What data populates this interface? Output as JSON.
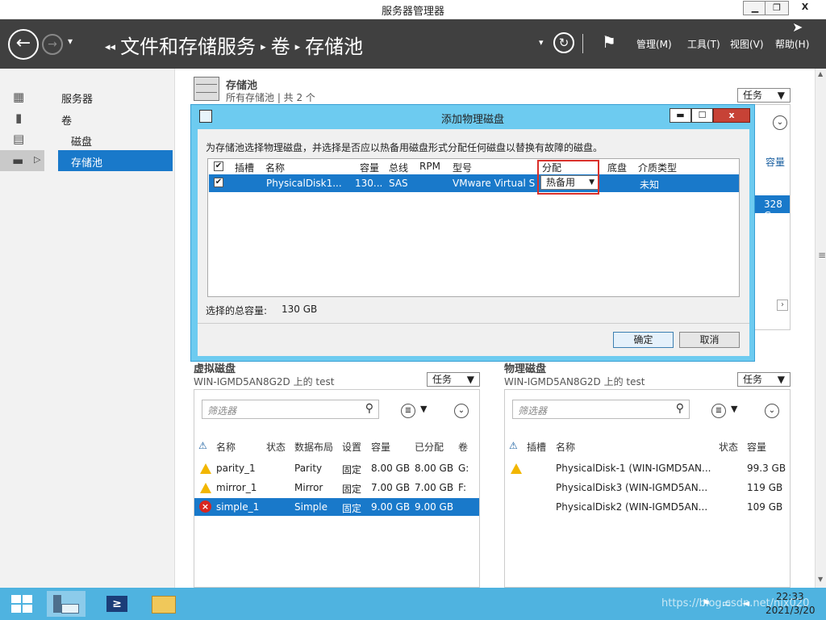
{
  "window": {
    "title": "服务器管理器",
    "min": "▁",
    "restore": "❐",
    "close": "X"
  },
  "header": {
    "breadcrumb": [
      "文件和存储服务",
      "卷",
      "存储池"
    ],
    "menus": [
      "管理(M)",
      "工具(T)",
      "视图(V)",
      "帮助(H)"
    ]
  },
  "nav": {
    "items": [
      "服务器",
      "卷",
      "磁盘",
      "存储池"
    ],
    "selected": "存储池"
  },
  "pool": {
    "title": "存储池",
    "subtitle": "所有存储池 | 共 2 个",
    "tasks": "任务",
    "col_capacity": "容量",
    "capacity_value": "328 G"
  },
  "dialog": {
    "title": "添加物理磁盘",
    "description": "为存储池选择物理磁盘，并选择是否应以热备用磁盘形式分配任何磁盘以替换有故障的磁盘。",
    "columns": [
      "插槽",
      "名称",
      "容量",
      "总线",
      "RPM",
      "型号",
      "分配",
      "底盘",
      "介质类型"
    ],
    "row": {
      "name": "PhysicalDisk1...",
      "capacity": "130...",
      "bus": "SAS",
      "model": "VMware Virtual S",
      "allocation": "热备用",
      "media": "未知"
    },
    "total_label": "选择的总容量:",
    "total_value": "130 GB",
    "ok": "确定",
    "cancel": "取消"
  },
  "vdisk": {
    "title": "虚拟磁盘",
    "subtitle": "WIN-IGMD5AN8G2D 上的 test",
    "tasks": "任务",
    "filter_placeholder": "筛选器",
    "columns": [
      "名称",
      "状态",
      "数据布局",
      "设置",
      "容量",
      "已分配",
      "卷"
    ],
    "rows": [
      {
        "name": "parity_1",
        "layout": "Parity",
        "setting": "固定",
        "capacity": "8.00 GB",
        "allocated": "8.00 GB",
        "volume": "G:",
        "status": "warning"
      },
      {
        "name": "mirror_1",
        "layout": "Mirror",
        "setting": "固定",
        "capacity": "7.00 GB",
        "allocated": "7.00 GB",
        "volume": "F:",
        "status": "warning"
      },
      {
        "name": "simple_1",
        "layout": "Simple",
        "setting": "固定",
        "capacity": "9.00 GB",
        "allocated": "9.00 GB",
        "volume": "",
        "status": "error"
      }
    ]
  },
  "pdisk": {
    "title": "物理磁盘",
    "subtitle": "WIN-IGMD5AN8G2D 上的 test",
    "tasks": "任务",
    "filter_placeholder": "筛选器",
    "columns": [
      "插槽",
      "名称",
      "状态",
      "容量"
    ],
    "rows": [
      {
        "name": "PhysicalDisk-1 (WIN-IGMD5AN...",
        "capacity": "99.3 GB",
        "status": "warning"
      },
      {
        "name": "PhysicalDisk3 (WIN-IGMD5AN...",
        "capacity": "119 GB",
        "status": ""
      },
      {
        "name": "PhysicalDisk2 (WIN-IGMD5AN...",
        "capacity": "109 GB",
        "status": ""
      }
    ]
  },
  "taskbar": {
    "time": "22:33",
    "date": "2021/3/20",
    "watermark": "https://blog.csdn.net/njx020"
  }
}
